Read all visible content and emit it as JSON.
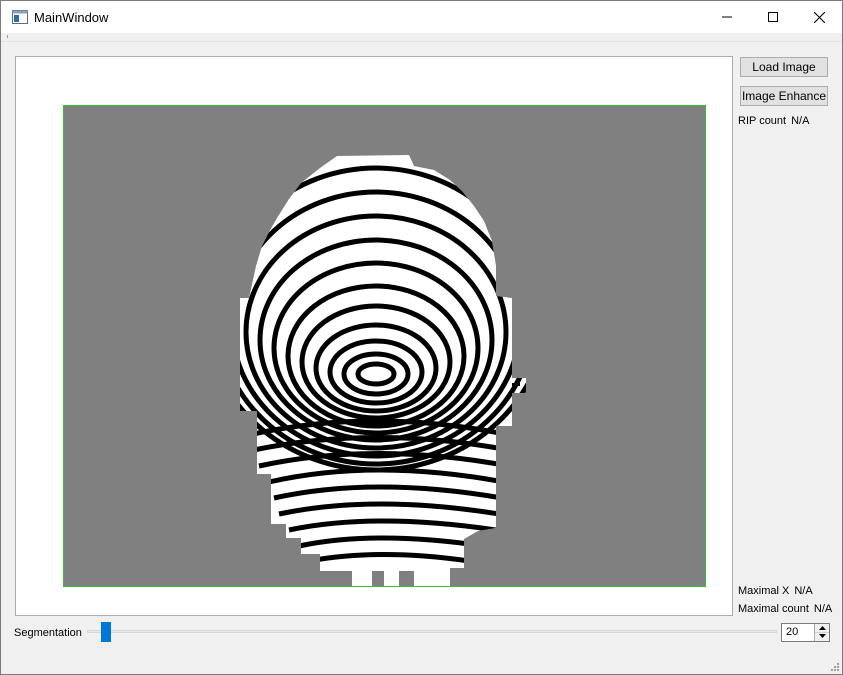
{
  "window": {
    "title": "MainWindow",
    "controls": [
      "minimize-icon",
      "maximize-icon",
      "close-icon"
    ]
  },
  "viewer": {
    "image_content": "fingerprint binarized image",
    "border_color": "#34c034",
    "background_color": "#808080"
  },
  "side_panel": {
    "load_button": "Load Image",
    "enhance_button": "Image Enhance",
    "rip_count_label": "RIP count",
    "rip_count_value": "N/A",
    "maximal_x_label": "Maximal X",
    "maximal_x_value": "N/A",
    "maximal_count_label": "Maximal count",
    "maximal_count_value": "N/A"
  },
  "segmentation": {
    "label": "Segmentation",
    "value": "20",
    "accent_color": "#0078d7"
  }
}
